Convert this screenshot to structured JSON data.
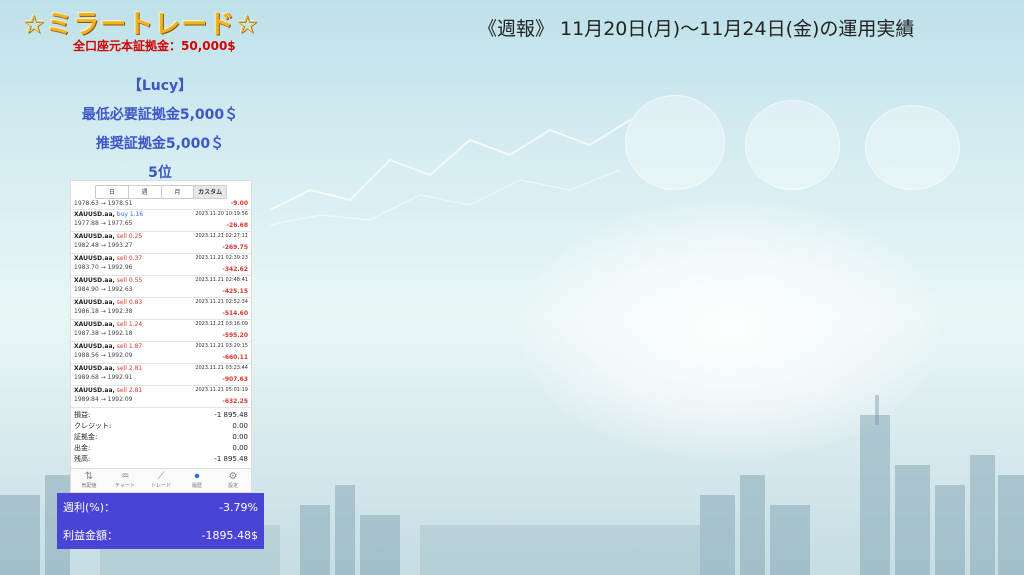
{
  "header": {
    "logo_text": "☆ミラートレード☆",
    "deposit_text": "全口座元本証拠金：50,000$",
    "week_title": "《週報》 11月20日(月)〜11月24日(金)の運用実績"
  },
  "strategy": {
    "name": "【Lucy】",
    "min_deposit": "最低必要証拠金5,000＄",
    "recommended_deposit": "推奨証拠金5,000＄",
    "rank": "5位"
  },
  "phone": {
    "tabs": [
      {
        "label": "日"
      },
      {
        "label": "週"
      },
      {
        "label": "月"
      },
      {
        "label": "カスタム"
      }
    ],
    "first_row": {
      "prices": "1978.63 → 1978.51",
      "pl": "-9.00"
    },
    "trades": [
      {
        "symbol": "XAUUSD.aa,",
        "side": "buy 1.16",
        "type": "buy",
        "time": "2023.11.20 10:19:56",
        "prices": "1977.88 → 1977.65",
        "pl": "-26.68"
      },
      {
        "symbol": "XAUUSD.aa,",
        "side": "sell 0.25",
        "type": "sell",
        "time": "2023.11.21 02:27:11",
        "prices": "1982.48 → 1993.27",
        "pl": "-269.75"
      },
      {
        "symbol": "XAUUSD.aa,",
        "side": "sell 0.37",
        "type": "sell",
        "time": "2023.11.21 02:39:23",
        "prices": "1983.70 → 1992.96",
        "pl": "-342.62"
      },
      {
        "symbol": "XAUUSD.aa,",
        "side": "sell 0.55",
        "type": "sell",
        "time": "2023.11.21 02:48:41",
        "prices": "1984.90 → 1992.63",
        "pl": "-425.15"
      },
      {
        "symbol": "XAUUSD.aa,",
        "side": "sell 0.83",
        "type": "sell",
        "time": "2023.11.21 02:52:34",
        "prices": "1986.18 → 1992.38",
        "pl": "-514.60"
      },
      {
        "symbol": "XAUUSD.aa,",
        "side": "sell 1.24",
        "type": "sell",
        "time": "2023.11.21 03:16:09",
        "prices": "1987.38 → 1992.18",
        "pl": "-595.20"
      },
      {
        "symbol": "XAUUSD.aa,",
        "side": "sell 1.87",
        "type": "sell",
        "time": "2023.11.21 03:20:15",
        "prices": "1988.56 → 1992.09",
        "pl": "-660.11"
      },
      {
        "symbol": "XAUUSD.aa,",
        "side": "sell 2.81",
        "type": "sell",
        "time": "2023.11.21 03:23:44",
        "prices": "1989.68 → 1992.91",
        "pl": "-907.63"
      },
      {
        "symbol": "XAUUSD.aa,",
        "side": "sell 2.81",
        "type": "sell",
        "time": "2023.11.21 05:01:19",
        "prices": "1989.84 → 1992.09",
        "pl": "-632.25"
      }
    ],
    "summary": [
      {
        "label": "損益:",
        "value": "-1 895.48"
      },
      {
        "label": "クレジット:",
        "value": "0.00"
      },
      {
        "label": "証拠金:",
        "value": "0.00"
      },
      {
        "label": "出金:",
        "value": "0.00"
      },
      {
        "label": "残高:",
        "value": "-1 895.48"
      }
    ],
    "nav": [
      {
        "label": "気配値",
        "icon": "⇅",
        "icon_name": "quotes-icon"
      },
      {
        "label": "チャート",
        "icon": "♒",
        "icon_name": "chart-icon"
      },
      {
        "label": "トレード",
        "icon": "⟋",
        "icon_name": "trade-icon"
      },
      {
        "label": "履歴",
        "icon": "⏺",
        "icon_name": "history-icon"
      },
      {
        "label": "設定",
        "icon": "⚙",
        "icon_name": "settings-icon"
      }
    ]
  },
  "result": {
    "weekly_label": "週利(%)：",
    "weekly_value": "-3.79%",
    "profit_label": "利益金額：",
    "profit_value": "-1895.48$"
  },
  "colors": {
    "accent_blue": "#4a44d6",
    "loss_red": "#d9352d",
    "title_gold": "#f0b323"
  }
}
